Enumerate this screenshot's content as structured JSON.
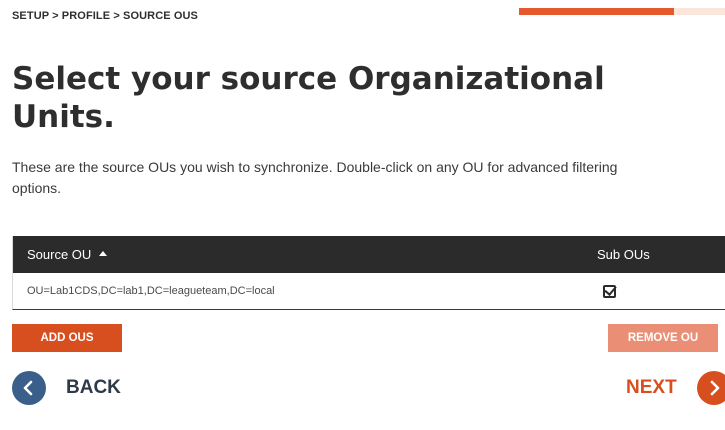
{
  "breadcrumb": "SETUP > PROFILE > SOURCE OUS",
  "progress": {
    "fraction": 0.75,
    "color": "#e45a2c",
    "track_color": "#fbe6dc"
  },
  "title": "Select your source Organizational Units.",
  "description": {
    "line1": "These are the source OUs you wish to synchronize. Double-click on any OU for advanced filtering",
    "line2": "options."
  },
  "table": {
    "columns": {
      "source_ou": "Source OU",
      "sub_ous": "Sub OUs"
    },
    "sort": {
      "column": "source_ou",
      "direction": "ascending"
    },
    "rows": [
      {
        "source_ou": "OU=Lab1CDS,DC=lab1,DC=leagueteam,DC=local",
        "sub_ous": true
      }
    ]
  },
  "buttons": {
    "add": "ADD OUS",
    "remove": "REMOVE OU"
  },
  "nav": {
    "back": "BACK",
    "next": "NEXT"
  },
  "colors": {
    "accent": "#d84f1f",
    "accent_disabled": "#ea8e76",
    "back_circle": "#3a5f8a",
    "header_bg": "#2b2b2b"
  },
  "icons": {
    "sort": "sort-ascending-icon",
    "checkbox": "checkbox-checked-icon",
    "back": "chevron-left-icon",
    "next": "chevron-right-icon"
  }
}
